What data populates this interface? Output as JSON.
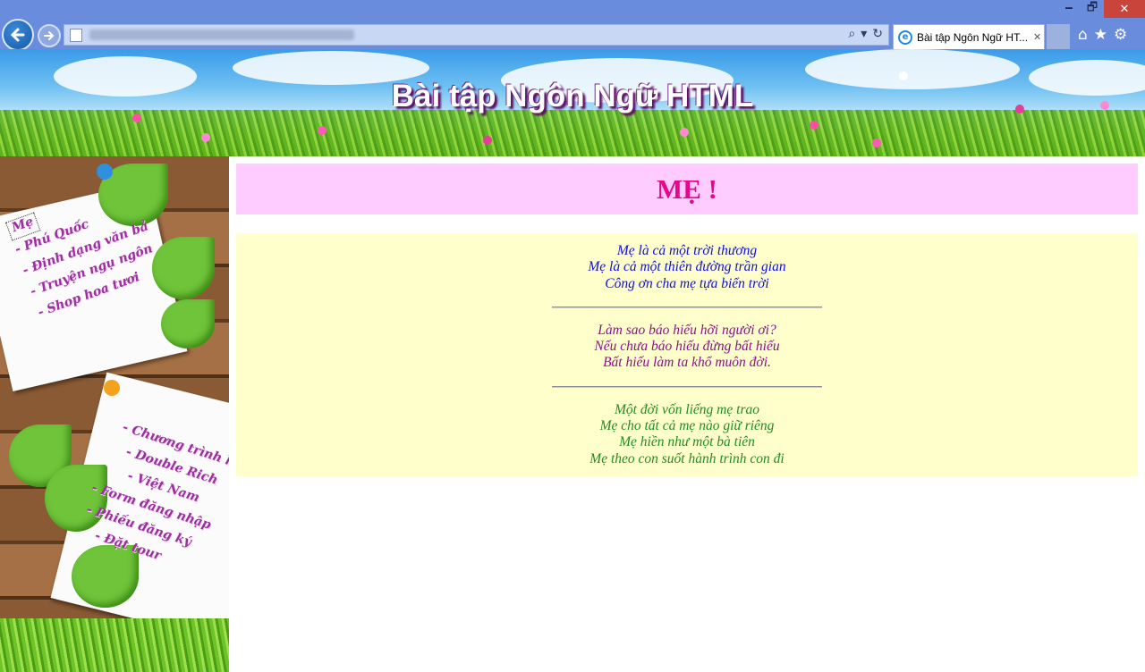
{
  "browser": {
    "tab_title": "Bài tập Ngôn Ngữ HT...",
    "window_buttons": {
      "minimize": "🗕",
      "restore": "🗗",
      "close": "✕"
    },
    "address_tools": [
      "⌕",
      "▾",
      "↻"
    ],
    "icons": [
      "back-arrow-icon",
      "forward-arrow-icon",
      "search-icon",
      "refresh-icon",
      "home-icon",
      "favorites-star-icon",
      "gear-icon",
      "ie-logo-icon"
    ]
  },
  "banner": {
    "title": "Bài tập Ngôn Ngữ HTML"
  },
  "sidebar": {
    "menu_top": [
      "Mẹ",
      "- Phú Quốc",
      "- Định dạng văn bả",
      "- Truyện ngụ ngôn",
      "- Shop hoa tươi"
    ],
    "menu_bottom": [
      "- Chương trình học",
      "- Double Rich",
      "- Việt Nam",
      "- Form đăng nhập",
      "- Phiếu đăng ký",
      "- Đặt tour"
    ]
  },
  "main": {
    "heading": "MẸ !",
    "stanzas": [
      [
        "Mẹ là cả một trời thương",
        "Mẹ là cả một thiên đường trần gian",
        "Công ơn cha mẹ tựa biển trời"
      ],
      [
        "Làm sao báo hiếu hỡi người ơi?",
        "Nếu chưa báo hiếu đừng bất hiếu",
        "Bất hiếu làm ta khổ muôn đời."
      ],
      [
        "Một đời vốn liếng mẹ trao",
        "Mẹ cho tất cả mẹ nào giữ riêng",
        "Mẹ hiền như một bà tiên",
        "Mẹ theo con suốt hành trình con đi"
      ]
    ]
  }
}
